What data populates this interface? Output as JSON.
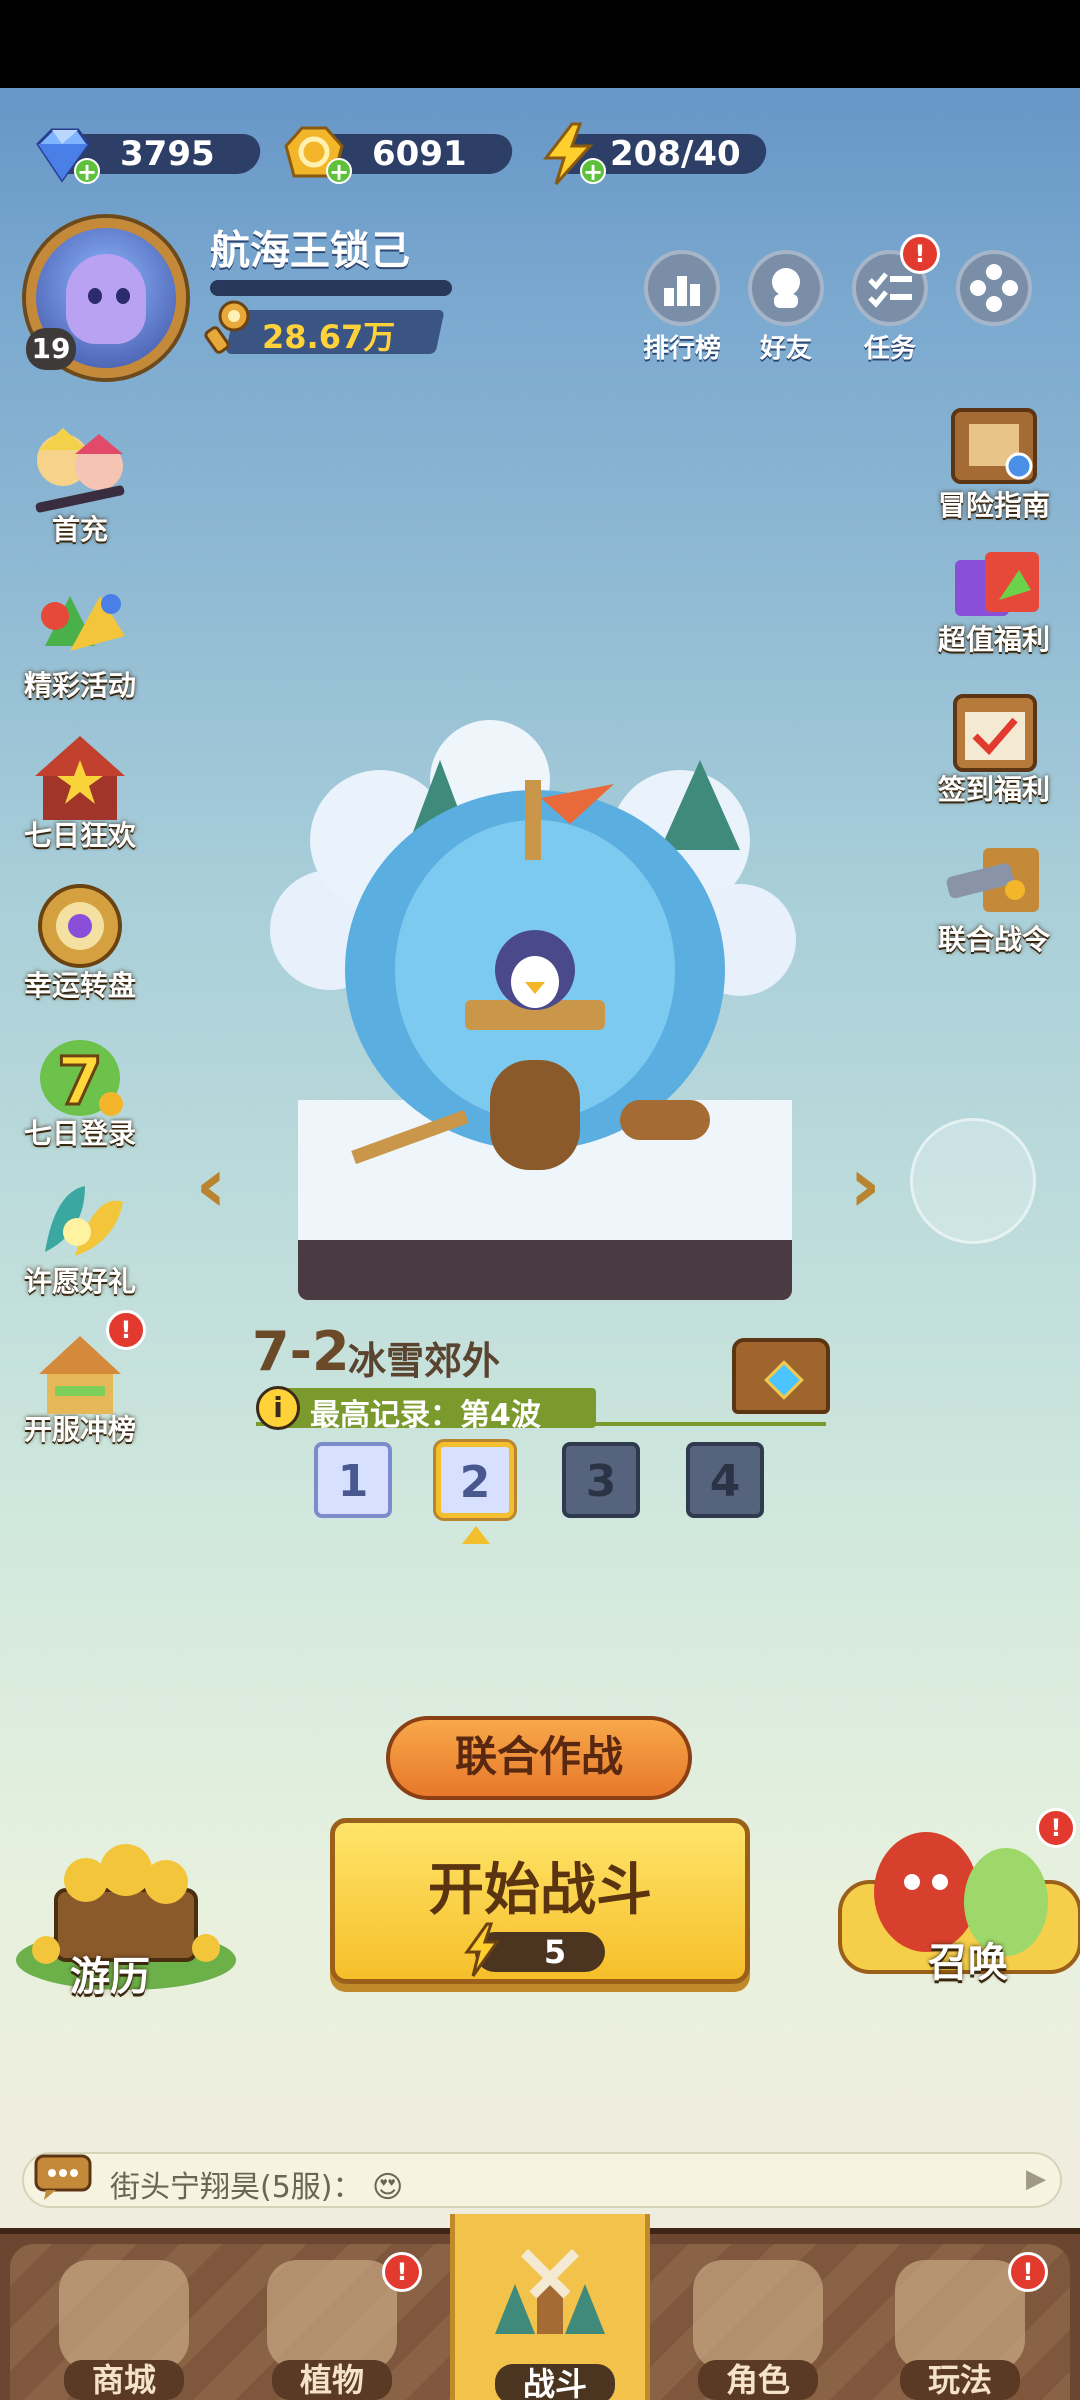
{
  "currencies": {
    "gems": "3795",
    "coins": "6091",
    "energy": "208/40"
  },
  "player": {
    "name": "航海王锁己",
    "level": "19",
    "xp_fraction": 0.0,
    "power": "28.67万"
  },
  "top_buttons": [
    {
      "label": "排行榜"
    },
    {
      "label": "好友"
    },
    {
      "label": "任务",
      "badge": "!"
    }
  ],
  "left_menu": [
    {
      "label": "首充"
    },
    {
      "label": "精彩活动"
    },
    {
      "label": "七日狂欢"
    },
    {
      "label": "幸运转盘"
    },
    {
      "label": "七日登录",
      "icon_text": "7"
    },
    {
      "label": "许愿好礼"
    },
    {
      "label": "开服冲榜",
      "badge": "!"
    }
  ],
  "right_menu": [
    {
      "label": "冒险指南"
    },
    {
      "label": "超值福利"
    },
    {
      "label": "签到福利"
    },
    {
      "label": "联合战令"
    }
  ],
  "stage": {
    "number": "7-2",
    "name": "冰雪郊外",
    "record": "最高记录：第4波",
    "info_icon": "i",
    "difficulties": [
      {
        "label": "1",
        "state": "unlocked"
      },
      {
        "label": "2",
        "state": "current"
      },
      {
        "label": "3",
        "state": "locked"
      },
      {
        "label": "4",
        "state": "locked"
      }
    ]
  },
  "actions": {
    "coop_label": "联合作战",
    "start_label": "开始战斗",
    "start_cost": "5",
    "travel_label": "游历",
    "summon_label": "召唤",
    "summon_badge": "!"
  },
  "chat": {
    "text": "街头宁翔昊(5服)： 😍",
    "arrow": "▶"
  },
  "bottom_nav": [
    {
      "label": "商城"
    },
    {
      "label": "植物",
      "badge": "!"
    },
    {
      "label": "战斗",
      "active": true
    },
    {
      "label": "角色"
    },
    {
      "label": "玩法",
      "badge": "!"
    }
  ],
  "colors": {
    "accent_yellow": "#f6bf2a",
    "badge_red": "#e23a2e",
    "nav_brown": "#6c4630"
  }
}
